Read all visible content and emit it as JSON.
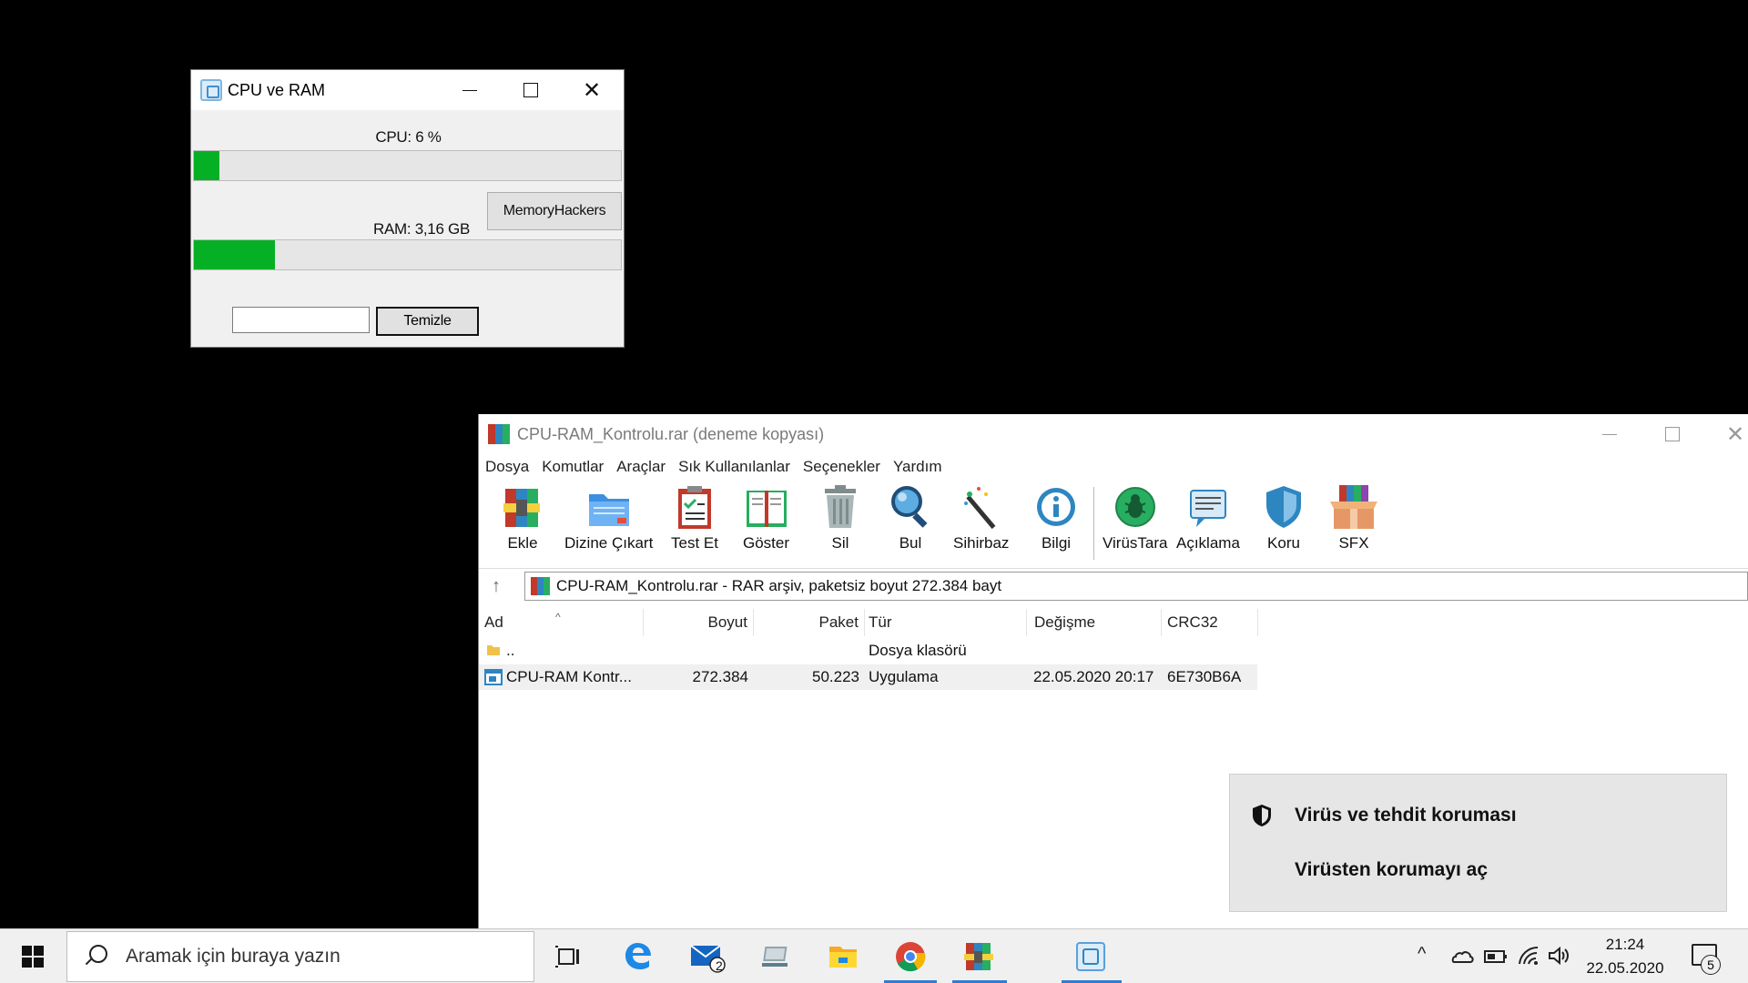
{
  "cpu_window": {
    "title": "CPU ve RAM",
    "cpu_label": "CPU: 6 %",
    "cpu_percent": 6,
    "ram_label": "RAM: 3,16 GB",
    "ram_fill_fraction": 0.19,
    "memory_button": "MemoryHackers",
    "input_value": "",
    "clean_button": "Temizle",
    "bar_color": "#06b025"
  },
  "rar_window": {
    "title": "CPU-RAM_Kontrolu.rar (deneme kopyası)",
    "menu": [
      "Dosya",
      "Komutlar",
      "Araçlar",
      "Sık Kullanılanlar",
      "Seçenekler",
      "Yardım"
    ],
    "toolbar": [
      {
        "label": "Ekle",
        "icon": "add-archive-icon"
      },
      {
        "label": "Dizine Çıkart",
        "icon": "extract-folder-icon"
      },
      {
        "label": "Test Et",
        "icon": "test-clipboard-icon"
      },
      {
        "label": "Göster",
        "icon": "view-book-icon"
      },
      {
        "label": "Sil",
        "icon": "trash-icon"
      },
      {
        "label": "Bul",
        "icon": "find-magnifier-icon"
      },
      {
        "label": "Sihirbaz",
        "icon": "wizard-wand-icon"
      },
      {
        "label": "Bilgi",
        "icon": "info-icon"
      },
      {
        "label": "VirüsTara",
        "icon": "virus-scan-icon"
      },
      {
        "label": "Açıklama",
        "icon": "comment-icon"
      },
      {
        "label": "Koru",
        "icon": "protect-shield-icon"
      },
      {
        "label": "SFX",
        "icon": "sfx-box-icon"
      }
    ],
    "address": "CPU-RAM_Kontrolu.rar - RAR arşiv, paketsiz boyut 272.384 bayt",
    "columns": [
      "Ad",
      "Boyut",
      "Paket",
      "Tür",
      "Değişme",
      "CRC32"
    ],
    "rows": [
      {
        "name": "..",
        "size": "",
        "packed": "",
        "type": "Dosya klasörü",
        "modified": "",
        "crc": ""
      },
      {
        "name": "CPU-RAM Kontr...",
        "size": "272.384",
        "packed": "50.223",
        "type": "Uygulama",
        "modified": "22.05.2020 20:17",
        "crc": "6E730B6A"
      }
    ]
  },
  "toast": {
    "title": "Virüs ve tehdit koruması",
    "action": "Virüsten korumayı aç"
  },
  "taskbar": {
    "search_placeholder": "Aramak için buraya yazın",
    "mail_badge": "2",
    "time": "21:24",
    "date": "22.05.2020",
    "notification_count": "5",
    "accent": "#2d7dd2"
  }
}
